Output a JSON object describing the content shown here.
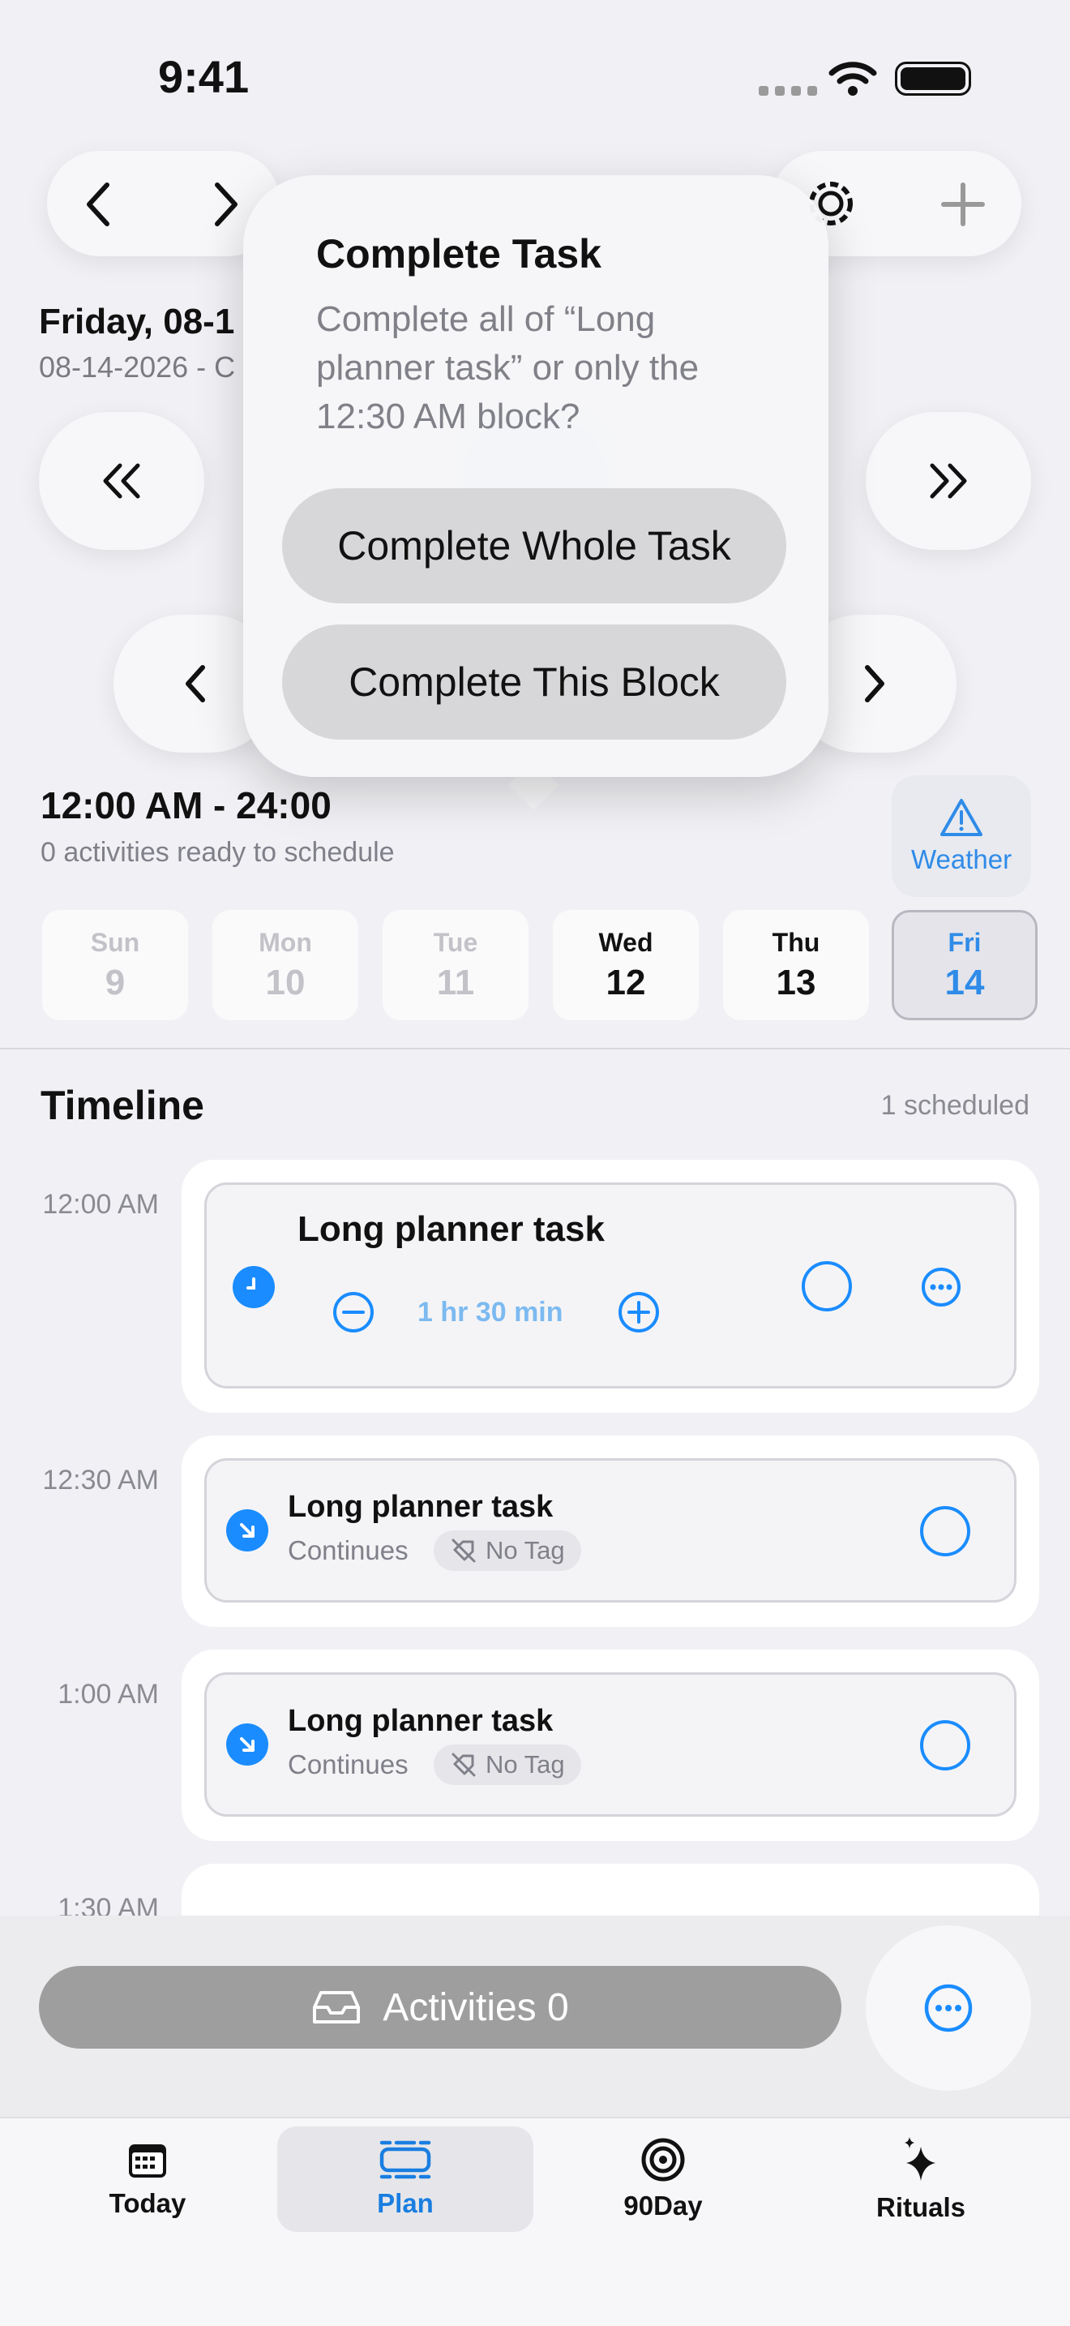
{
  "status_bar": {
    "time": "9:41"
  },
  "header": {
    "date_title": "Friday, 08-1",
    "date_sub": "08-14-2026 - C"
  },
  "popover": {
    "title": "Complete Task",
    "message": "Complete all of “Long planner task” or only the 12:30 AM block?",
    "buttons": [
      "Complete Whole Task",
      "Complete This Block"
    ]
  },
  "range": {
    "title": "12:00 AM - 24:00",
    "subtitle": "0 activities ready to schedule",
    "weather_label": "Weather"
  },
  "days": [
    {
      "name": "Sun",
      "num": "9",
      "state": "past"
    },
    {
      "name": "Mon",
      "num": "10",
      "state": "past"
    },
    {
      "name": "Tue",
      "num": "11",
      "state": "past"
    },
    {
      "name": "Wed",
      "num": "12",
      "state": "active"
    },
    {
      "name": "Thu",
      "num": "13",
      "state": "active"
    },
    {
      "name": "Fri",
      "num": "14",
      "state": "selected"
    }
  ],
  "timeline": {
    "title": "Timeline",
    "count": "1 scheduled",
    "slots": [
      {
        "time": "12:00 AM",
        "task": "Long planner task",
        "duration": "1 hr 30 min"
      },
      {
        "time": "12:30 AM",
        "task": "Long planner task",
        "continues": "Continues",
        "tag": "No Tag"
      },
      {
        "time": "1:00 AM",
        "task": "Long planner task",
        "continues": "Continues",
        "tag": "No Tag"
      },
      {
        "time": "1:30 AM"
      }
    ]
  },
  "bottom": {
    "activities_label": "Activities 0"
  },
  "tabs": [
    {
      "label": "Today",
      "icon": "calendar-icon"
    },
    {
      "label": "Plan",
      "icon": "plan-icon",
      "selected": true
    },
    {
      "label": "90Day",
      "icon": "target-icon"
    },
    {
      "label": "Rituals",
      "icon": "sparkles-icon"
    }
  ],
  "colors": {
    "accent": "#1a8cff",
    "tab_selected": "#1a7ee0"
  }
}
